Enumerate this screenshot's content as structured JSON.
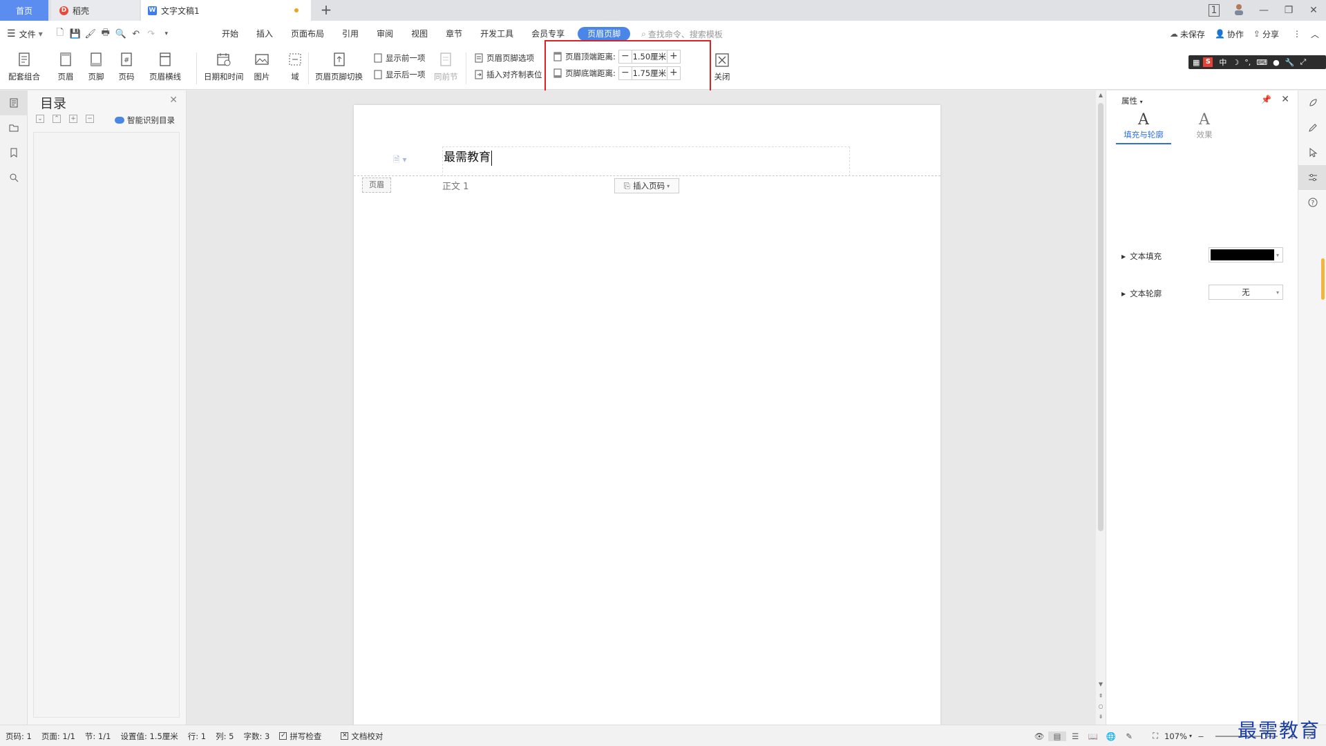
{
  "tabs": {
    "home": "首页",
    "daoke": "稻壳",
    "doc": "文字文稿1",
    "add": "+"
  },
  "window": {
    "badge": "1"
  },
  "menu": {
    "file": "文件",
    "tabs": [
      "开始",
      "插入",
      "页面布局",
      "引用",
      "审阅",
      "视图",
      "章节",
      "开发工具",
      "会员专享",
      "页眉页脚"
    ],
    "search_placeholder": "查找命令、搜索模板",
    "right": {
      "unsaved": "未保存",
      "collab": "协作",
      "share": "分享"
    }
  },
  "ribbon": {
    "combo": "配套组合",
    "header": "页眉",
    "footer": "页脚",
    "page_number": "页码",
    "header_line": "页眉横线",
    "datetime": "日期和时间",
    "picture": "图片",
    "field": "域",
    "switch": "页眉页脚切换",
    "show_prev": "显示前一项",
    "show_next": "显示后一项",
    "same_as_prev": "同前节",
    "options": "页眉页脚选项",
    "insert_align_tab": "插入对齐制表位",
    "header_top_label": "页眉顶端距离:",
    "header_top_value": "1.50厘米",
    "footer_bottom_label": "页脚底端距离:",
    "footer_bottom_value": "1.75厘米",
    "close": "关闭"
  },
  "ime": {
    "lang": "中"
  },
  "toc": {
    "title": "目录",
    "smart": "智能识别目录"
  },
  "document": {
    "header_text": "最需教育",
    "header_tag": "页眉",
    "style_label": "正文 1",
    "insert_page_number": "插入页码"
  },
  "properties": {
    "title": "属性",
    "tab_fill": "填充与轮廓",
    "tab_effect": "效果",
    "text_fill": "文本填充",
    "text_outline": "文本轮廓",
    "outline_value": "无",
    "fill_color": "#000000"
  },
  "status": {
    "page_code": "页码: 1",
    "page": "页面: 1/1",
    "section": "节: 1/1",
    "setting": "设置值: 1.5厘米",
    "row": "行: 1",
    "col": "列: 5",
    "word_count": "字数: 3",
    "spell": "拼写检查",
    "proof": "文档校对",
    "zoom": "107%"
  },
  "watermark": "最需教育",
  "colors": {
    "accent": "#4a86e8",
    "highlight_box": "#e02020"
  }
}
